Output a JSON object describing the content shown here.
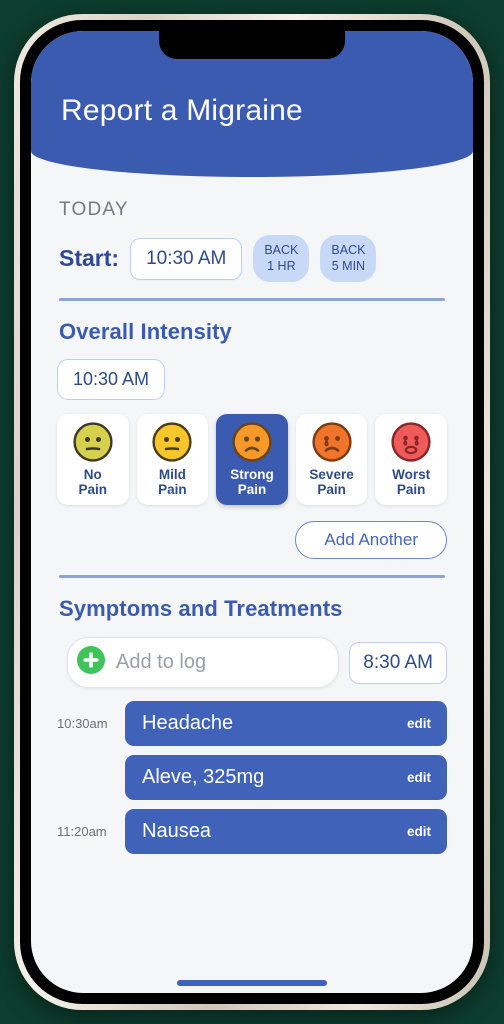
{
  "header": {
    "title": "Report a Migraine",
    "accent_color": "#3a5bb0"
  },
  "today": {
    "label": "TODAY",
    "start_label": "Start:",
    "start_time": "10:30 AM",
    "back_buttons": [
      {
        "line1": "BACK",
        "line2": "1 HR"
      },
      {
        "line1": "BACK",
        "line2": "5 MIN"
      }
    ]
  },
  "intensity": {
    "title": "Overall Intensity",
    "time": "10:30 AM",
    "selected_index": 2,
    "options": [
      {
        "label_line1": "No",
        "label_line2": "Pain",
        "face": "neutral",
        "color": "#d6d04f",
        "stroke": "#3d3a24"
      },
      {
        "label_line1": "Mild",
        "label_line2": "Pain",
        "face": "neutral",
        "color": "#f7c62a",
        "stroke": "#4a3d12"
      },
      {
        "label_line1": "Strong",
        "label_line2": "Pain",
        "face": "frown",
        "color": "#f59a28",
        "stroke": "#6b4415"
      },
      {
        "label_line1": "Severe",
        "label_line2": "Pain",
        "face": "tear",
        "color": "#f0752a",
        "stroke": "#7a3a12"
      },
      {
        "label_line1": "Worst",
        "label_line2": "Pain",
        "face": "cry",
        "color": "#ef5a5a",
        "stroke": "#8a2626"
      }
    ],
    "add_another_label": "Add Another"
  },
  "symptoms": {
    "title": "Symptoms and Treatments",
    "add_icon": "plus-circle-icon",
    "add_placeholder": "Add to log",
    "log_time": "8:30 AM",
    "entries": [
      {
        "time": "10:30am",
        "label": "Headache",
        "edit": "edit"
      },
      {
        "time": "",
        "label": "Aleve, 325mg",
        "edit": "edit"
      },
      {
        "time": "11:20am",
        "label": "Nausea",
        "edit": "edit"
      }
    ]
  }
}
